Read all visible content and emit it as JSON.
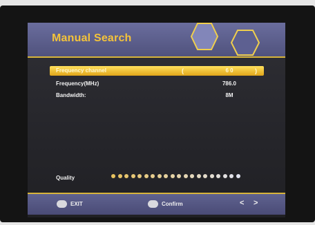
{
  "header": {
    "title": "Manual Search"
  },
  "settings": [
    {
      "label": "Frequency channel",
      "value": "6 0",
      "left_arrow": "(",
      "right_arrow": ")"
    },
    {
      "label": "Frequency(MHz)",
      "value": "786.0"
    },
    {
      "label": "Bandwidth:",
      "value": "8M"
    }
  ],
  "quality": {
    "label": "Quality",
    "dot_count": 20
  },
  "footer": {
    "exit_label": "EXIT",
    "confirm_label": "Confirm",
    "left_nav": "<",
    "right_nav": ">"
  },
  "colors": {
    "accent": "#f4c33a",
    "header_bg": "#5e6190",
    "selected_row": "#f4c53a"
  }
}
